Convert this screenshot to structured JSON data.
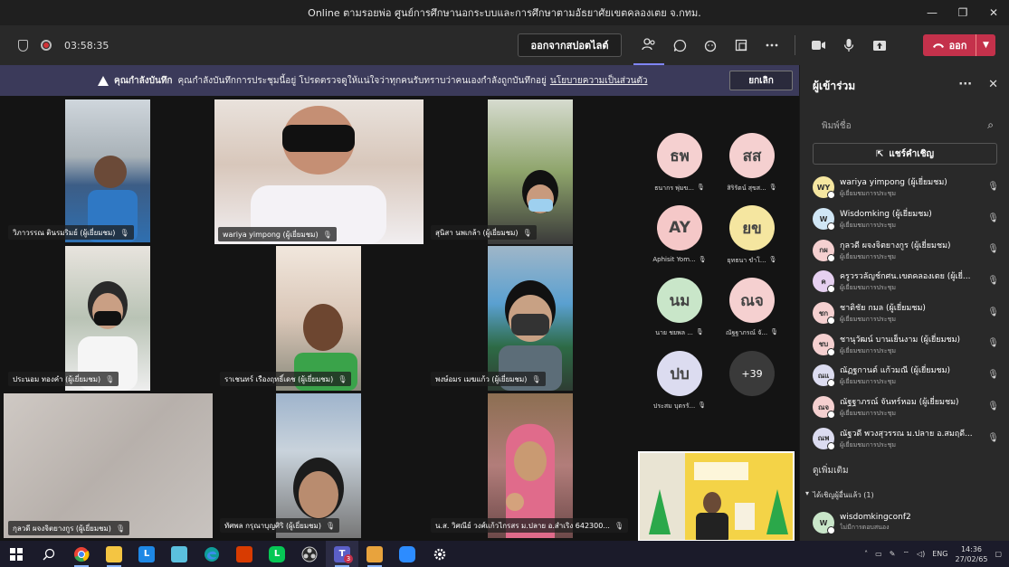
{
  "window": {
    "title": "Online ตามรอยพ่อ ศูนย์การศึกษานอกระบบและการศึกษาตามอัธยาศัยเขตคลองเตย จ.กทม.",
    "minimize": "—",
    "maximize": "❐",
    "close": "✕"
  },
  "toolbar": {
    "timer": "03:58:35",
    "leave_spotlight": "ออกจากสปอตไลต์",
    "leave_label": "ออก",
    "icons": [
      "people-icon",
      "chat-icon",
      "reactions-icon",
      "rooms-icon",
      "more-icon",
      "camera-icon",
      "mic-icon",
      "share-icon"
    ]
  },
  "banner": {
    "title": "คุณกำลังบันทึก",
    "message": "คุณกำลังบันทึกการประชุมนี้อยู่ โปรดตรวจดูให้แน่ใจว่าทุกคนรับทราบว่าคนเองกำลังถูกบันทึกอยู่",
    "link": "นโยบายความเป็นส่วนตัว",
    "cancel": "ยกเลิก"
  },
  "tiles": [
    {
      "name": "วิภาวรรณ ตินรมริมย์ (ผู้เยี่ยมชม)"
    },
    {
      "name": "wariya yimpong (ผู้เยี่ยมชม)"
    },
    {
      "name": "สุนิสา นพเกล้า (ผู้เยี่ยมชม)"
    },
    {
      "name": "ประนอม ทองคำ (ผู้เยี่ยมชม)"
    },
    {
      "name": "ราเชนทร์ เรืองฤทธิ์เดช (ผู้เยี่ยมชม)"
    },
    {
      "name": "พงษ์อมร เมฆแก้ว (ผู้เยี่ยมชม)"
    },
    {
      "name": "กุลวดี ผจงจิตยางกูร (ผู้เยี่ยมชม)"
    },
    {
      "name": "ทัศพล กรุณาบุญศิริ (ผู้เยี่ยมชม)"
    },
    {
      "name": "น.ส. วิศณีย์ วงศ์แก้วไกรสร ม.ปลาย อ.สำเริง 642300..."
    }
  ],
  "avatars": [
    {
      "initials": "ธพ",
      "label": "ธนากร พุ่มข...",
      "color": "#f5d0d0"
    },
    {
      "initials": "สส",
      "label": "สิริรัตน์ สุขส...",
      "color": "#f5d0d0"
    },
    {
      "initials": "AY",
      "label": "Aphisit Yom...",
      "color": "#f5c8c8"
    },
    {
      "initials": "ยข",
      "label": "ยุทธนา ขำโ...",
      "color": "#f5e6a0"
    },
    {
      "initials": "นม",
      "label": "นาย ชยพล ...",
      "color": "#c9e6c9"
    },
    {
      "initials": "ณจ",
      "label": "ณัฐฐาภรณ์ จั...",
      "color": "#f5d0d0"
    },
    {
      "initials": "ปบ",
      "label": "ประสม บุตรรั...",
      "color": "#dcdcf0"
    },
    {
      "initials": "+39",
      "label": "",
      "color": "#3a3a3a"
    }
  ],
  "panel": {
    "title": "ผู้เข้าร่วม",
    "search_placeholder": "พิมพ์ชื่อ",
    "share_invite": "แชร์คำเชิญ",
    "participants": [
      {
        "initials": "WY",
        "name": "wariya yimpong (ผู้เยี่ยมชม)",
        "role": "ผู้เยี่ยมชมการประชุม",
        "color": "#f5e6a0"
      },
      {
        "initials": "W",
        "name": "Wisdomking (ผู้เยี่ยมชม)",
        "role": "ผู้เยี่ยมชมการประชุม",
        "color": "#d0e6f5"
      },
      {
        "initials": "กผ",
        "name": "กุลวดี ผจงจิตยางกูร (ผู้เยี่ยมชม)",
        "role": "ผู้เยี่ยมชมการประชุม",
        "color": "#f5d0d0"
      },
      {
        "initials": "ค",
        "name": "ครูวรวลัญช์กศน.เขตคลองเตย (ผู้เยี่...",
        "role": "ผู้เยี่ยมชมการประชุม",
        "color": "#e6d0f0"
      },
      {
        "initials": "ชก",
        "name": "ชาติชัย กมล (ผู้เยี่ยมชม)",
        "role": "ผู้เยี่ยมชมการประชุม",
        "color": "#f5d0d0"
      },
      {
        "initials": "ชบ",
        "name": "ชานุวัฒน์ บานเย็นงาม (ผู้เยี่ยมชม)",
        "role": "ผู้เยี่ยมชมการประชุม",
        "color": "#f5d0d0"
      },
      {
        "initials": "ณแ",
        "name": "ณัฏฐกานต์ แก้วมณี (ผู้เยี่ยมชม)",
        "role": "ผู้เยี่ยมชมการประชุม",
        "color": "#dcdcf0"
      },
      {
        "initials": "ณจ",
        "name": "ณัฐฐาภรณ์ จันทร์หอม (ผู้เยี่ยมชม)",
        "role": "ผู้เยี่ยมชมการประชุม",
        "color": "#f5d0d0"
      },
      {
        "initials": "ณพ",
        "name": "ณัฐวดี พวงสุวรรณ ม.ปลาย อ.สมฤดี...",
        "role": "ผู้เยี่ยมชมการประชุม",
        "color": "#dcdcf0"
      }
    ],
    "see_more": "ดูเพิ่มเติม",
    "invited_header": "ได้เชิญผู้อื่นแล้ว (1)",
    "invitee": {
      "initials": "W",
      "name": "wisdomkingconf2",
      "role": "ไม่มีการตอบสนอง",
      "color": "#c9e6c9"
    }
  },
  "taskbar": {
    "lang": "ENG",
    "time": "14:36",
    "date": "27/02/65",
    "apps": [
      "start-icon",
      "search-icon",
      "chrome-icon",
      "explorer-icon",
      "lms-icon",
      "notepad-icon",
      "edge-icon",
      "office-icon",
      "line-icon",
      "obs-icon",
      "teams-icon",
      "media-icon",
      "zoom-icon",
      "settings-icon"
    ],
    "teams_badge": "3"
  }
}
